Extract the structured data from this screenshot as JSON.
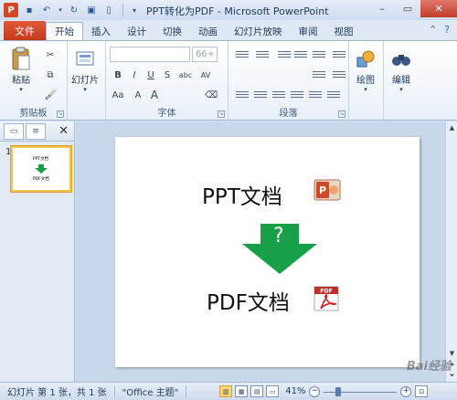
{
  "window": {
    "title": "PPT转化为PDF - Microsoft PowerPoint",
    "app_icon_letter": "P"
  },
  "qat": {
    "icons": [
      "save-icon",
      "undo-icon",
      "redo-icon",
      "print-preview-icon",
      "new-icon",
      "customize-icon"
    ]
  },
  "tabs": {
    "file": "文件",
    "items": [
      "开始",
      "插入",
      "设计",
      "切换",
      "动画",
      "幻灯片放映",
      "审阅",
      "视图"
    ],
    "active": "开始"
  },
  "ribbon": {
    "clipboard": {
      "label": "剪贴板",
      "paste": "粘贴"
    },
    "slides": {
      "new_slide": "幻灯片"
    },
    "font": {
      "label": "字体",
      "size_value": "66+",
      "buttons": [
        "B",
        "I",
        "U",
        "S",
        "abc",
        "AV",
        "Aa",
        "A",
        "A"
      ]
    },
    "paragraph": {
      "label": "段落"
    },
    "drawing": {
      "label": "绘图"
    },
    "editing": {
      "label": "编辑"
    }
  },
  "panel": {
    "close": "✕",
    "slide_number": "1",
    "thumb_line1": "PPT文档",
    "thumb_line2": "PDF文档"
  },
  "slide": {
    "title_top": "PPT文档",
    "question_mark": "?",
    "title_bottom": "PDF文档",
    "pdf_badge": "PDF"
  },
  "status": {
    "slide_info": "幻灯片 第 1 张，共 1 张",
    "theme": "\"Office 主题\"",
    "zoom": "41%",
    "zoom_level_fraction": 0.41
  },
  "watermark": "Bai经验",
  "colors": {
    "file_tab": "#d24726",
    "arrow_green": "#18a048",
    "thumb_highlight": "#f2c64a"
  }
}
